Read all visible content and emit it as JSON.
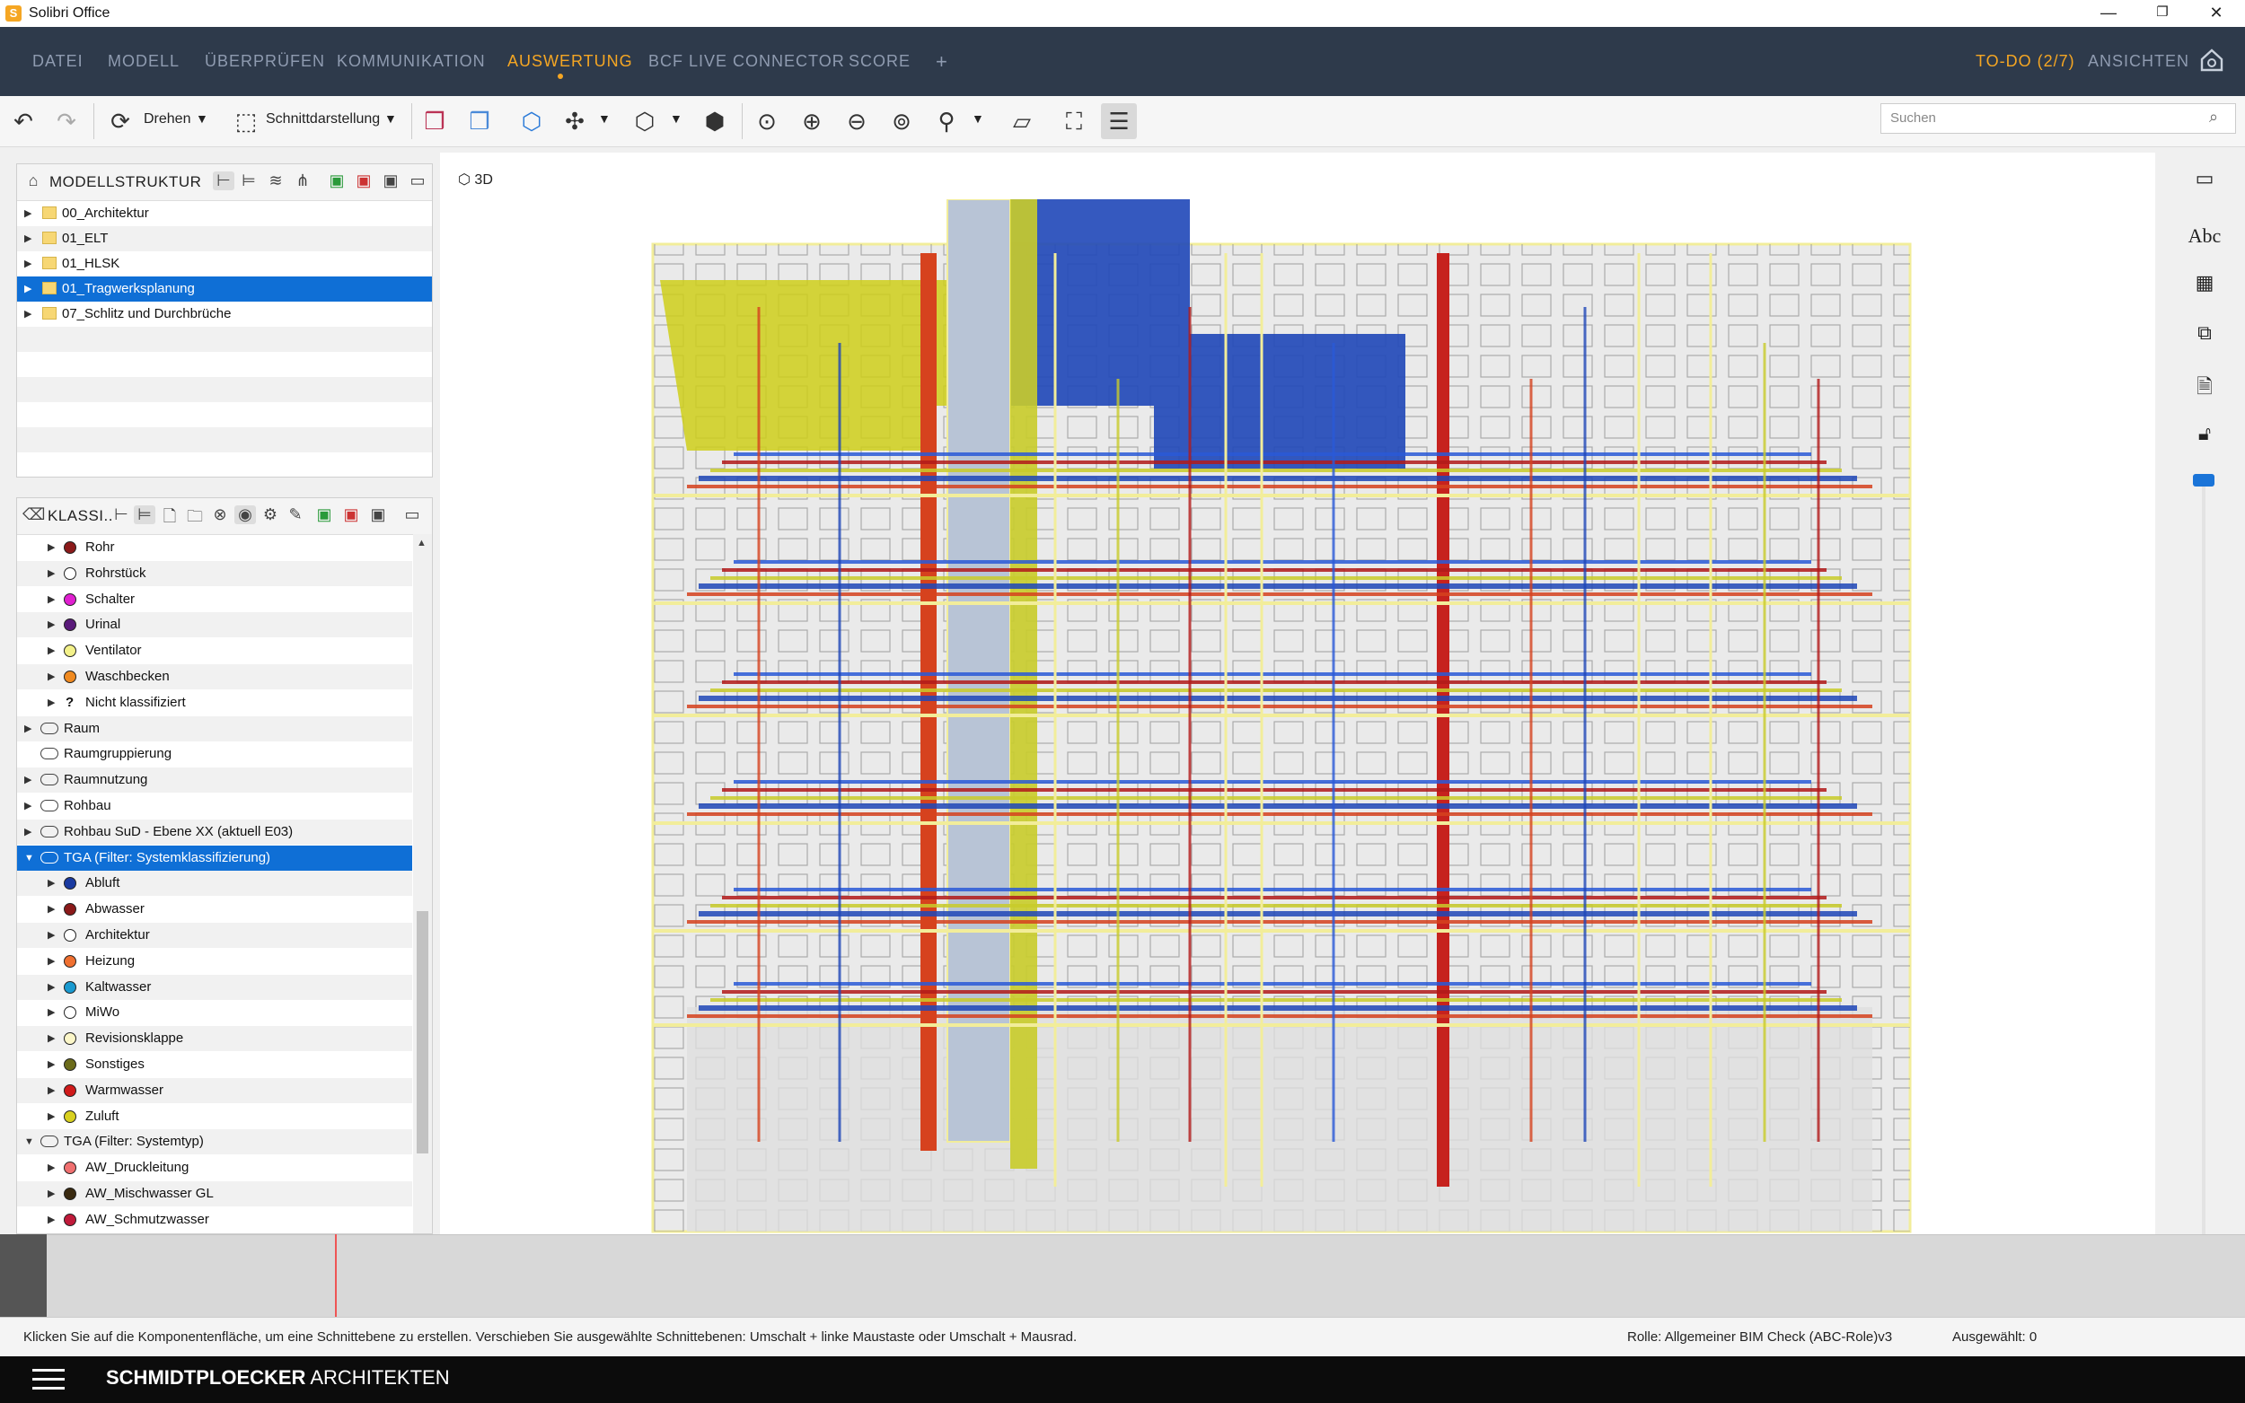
{
  "window": {
    "title": "Solibri Office",
    "icon_letter": "S",
    "minimize": "—",
    "maximize": "❐",
    "close": "✕"
  },
  "menu": {
    "items": [
      "DATEI",
      "MODELL",
      "ÜBERPRÜFEN",
      "KOMMUNIKATION",
      "AUSWERTUNG",
      "BCF LIVE CONNECTOR",
      "SCORE"
    ],
    "active": "AUSWERTUNG",
    "add": "+",
    "todo": "TO-DO (2/7)",
    "ansichten": "ANSICHTEN"
  },
  "toolbar": {
    "rotate_label": "Drehen",
    "section_label": "Schnittdarstellung",
    "search_placeholder": "Suchen"
  },
  "model_tree": {
    "title": "MODELLSTRUKTUR",
    "items": [
      {
        "label": "00_Architektur",
        "selected": false
      },
      {
        "label": "01_ELT",
        "selected": false
      },
      {
        "label": "01_HLSK",
        "selected": false
      },
      {
        "label": "01_Tragwerksplanung",
        "selected": true
      },
      {
        "label": "07_Schlitz und Durchbrüche",
        "selected": false
      }
    ]
  },
  "classification": {
    "title": "KLASSI..",
    "rows": [
      {
        "label": "Rohr",
        "level": 2,
        "kind": "dot",
        "color": "#8b1a1a"
      },
      {
        "label": "Rohrstück",
        "level": 2,
        "kind": "dot",
        "color": "#ffffff"
      },
      {
        "label": "Schalter",
        "level": 2,
        "kind": "dot",
        "color": "#e020d0"
      },
      {
        "label": "Urinal",
        "level": 2,
        "kind": "dot",
        "color": "#5a1a7a"
      },
      {
        "label": "Ventilator",
        "level": 2,
        "kind": "dot",
        "color": "#f3f18a"
      },
      {
        "label": "Waschbecken",
        "level": 2,
        "kind": "dot",
        "color": "#f08a20"
      },
      {
        "label": "Nicht klassifiziert",
        "level": 2,
        "kind": "question",
        "color": ""
      },
      {
        "label": "Raum",
        "level": 1,
        "kind": "class",
        "color": ""
      },
      {
        "label": "Raumgruppierung",
        "level": 1,
        "kind": "class-noarrow",
        "color": ""
      },
      {
        "label": "Raumnutzung",
        "level": 1,
        "kind": "class",
        "color": ""
      },
      {
        "label": "Rohbau",
        "level": 1,
        "kind": "class",
        "color": ""
      },
      {
        "label": "Rohbau SuD - Ebene XX (aktuell E03)",
        "level": 1,
        "kind": "class",
        "color": ""
      },
      {
        "label": "TGA (Filter: Systemklassifizierung)",
        "level": 1,
        "kind": "class-open",
        "color": "",
        "selected": true
      },
      {
        "label": "Abluft",
        "level": 2,
        "kind": "dot",
        "color": "#1a3aa0"
      },
      {
        "label": "Abwasser",
        "level": 2,
        "kind": "dot",
        "color": "#8b1a1a"
      },
      {
        "label": "Architektur",
        "level": 2,
        "kind": "dot",
        "color": "#ffffff"
      },
      {
        "label": "Heizung",
        "level": 2,
        "kind": "dot",
        "color": "#f07030"
      },
      {
        "label": "Kaltwasser",
        "level": 2,
        "kind": "dot",
        "color": "#1a9ad0"
      },
      {
        "label": "MiWo",
        "level": 2,
        "kind": "dot",
        "color": "#ffffff"
      },
      {
        "label": "Revisionsklappe",
        "level": 2,
        "kind": "dot",
        "color": "#fbf6c8"
      },
      {
        "label": "Sonstiges",
        "level": 2,
        "kind": "dot",
        "color": "#6b6b1a"
      },
      {
        "label": "Warmwasser",
        "level": 2,
        "kind": "dot",
        "color": "#d01a1a"
      },
      {
        "label": "Zuluft",
        "level": 2,
        "kind": "dot",
        "color": "#d8d020"
      },
      {
        "label": "TGA (Filter: Systemtyp)",
        "level": 1,
        "kind": "class-open",
        "color": ""
      },
      {
        "label": "AW_Druckleitung",
        "level": 2,
        "kind": "dot",
        "color": "#f07070"
      },
      {
        "label": "AW_Mischwasser GL",
        "level": 2,
        "kind": "dot",
        "color": "#3a2a10"
      },
      {
        "label": "AW_Schmutzwasser",
        "level": 2,
        "kind": "dot",
        "color": "#c01a3a"
      }
    ]
  },
  "viewport": {
    "label": "3D"
  },
  "side_panel": {
    "text_icon": "Abc"
  },
  "status": {
    "hint": "Klicken Sie auf die Komponentenfläche, um eine Schnittebene zu erstellen. Verschieben Sie ausgewählte Schnittebenen: Umschalt + linke Maustaste oder Umschalt + Mausrad.",
    "role": "Rolle: Allgemeiner BIM Check (ABC-Role)v3",
    "selected": "Ausgewählt: 0"
  },
  "footer": {
    "brand_bold": "SCHMIDTPLOECKER",
    "brand_rest": " ARCHITEKTEN"
  }
}
